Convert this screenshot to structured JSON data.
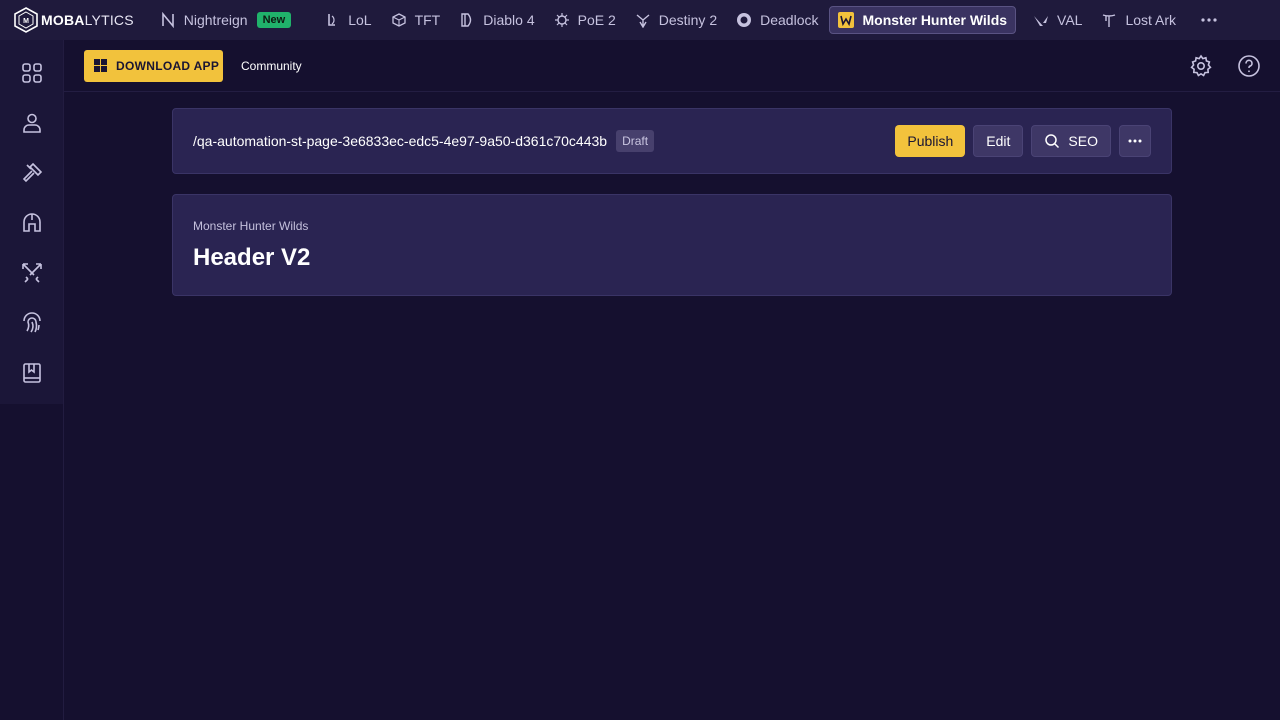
{
  "brand": {
    "bold": "MOBA",
    "light": "LYTICS"
  },
  "games": [
    {
      "label": "Nightreign",
      "icon": "nightreign-icon",
      "badge": "New"
    },
    {
      "label": "LoL",
      "icon": "lol-icon"
    },
    {
      "label": "TFT",
      "icon": "tft-icon"
    },
    {
      "label": "Diablo 4",
      "icon": "diablo-icon"
    },
    {
      "label": "PoE 2",
      "icon": "poe-icon"
    },
    {
      "label": "Destiny 2",
      "icon": "destiny-icon"
    },
    {
      "label": "Deadlock",
      "icon": "deadlock-icon"
    },
    {
      "label": "Monster Hunter Wilds",
      "icon": "mhw-icon",
      "active": true
    },
    {
      "label": "VAL",
      "icon": "valorant-icon"
    },
    {
      "label": "Lost Ark",
      "icon": "lost-ark-icon"
    }
  ],
  "sidebar": {
    "items": [
      {
        "icon": "apps-grid-icon"
      },
      {
        "icon": "user-icon"
      },
      {
        "icon": "hammer-icon"
      },
      {
        "icon": "helmet-icon"
      },
      {
        "icon": "crossed-swords-icon"
      },
      {
        "icon": "fingerprint-icon"
      },
      {
        "icon": "bookmark-book-icon"
      }
    ]
  },
  "subheader": {
    "download_label": "DOWNLOAD APP",
    "community_label": "Community"
  },
  "page_bar": {
    "path": "/qa-automation-st-page-3e6833ec-edc5-4e97-9a50-d361c70c443b",
    "status": "Draft",
    "publish_label": "Publish",
    "edit_label": "Edit",
    "seo_label": "SEO"
  },
  "content": {
    "game": "Monster Hunter Wilds",
    "title": "Header V2"
  },
  "colors": {
    "background": "#15102f",
    "topbar": "#1f1a3c",
    "accent": "#f2c23c",
    "card": "#2a2452",
    "new_badge": "#20b26b"
  }
}
